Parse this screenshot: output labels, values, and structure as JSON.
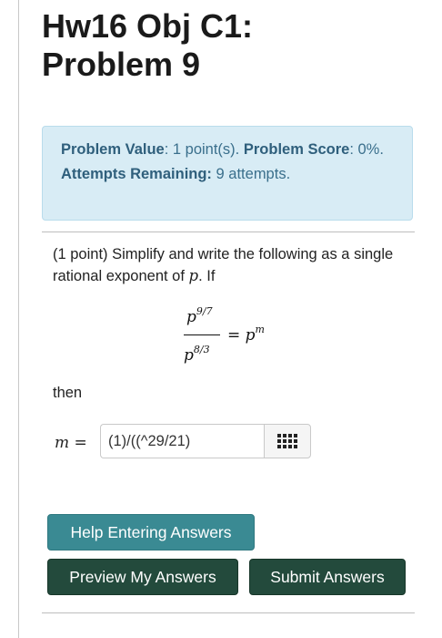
{
  "title": {
    "line1": "Hw16 Obj C1:",
    "line2": "Problem 9"
  },
  "info": {
    "value_label": "Problem Value",
    "value_text": ": 1 point(s).",
    "score_label": "Problem Score",
    "score_text": ": 0%.",
    "attempts_label": "Attempts Remaining:",
    "attempts_text": "9 attempts."
  },
  "problem": {
    "text_before": "(1 point) Simplify and write the following as a single rational exponent of",
    "var": "p",
    "text_after": ". If",
    "numerator_base": "p",
    "numerator_exp": "9/7",
    "denominator_base": "p",
    "denominator_exp": "8/3",
    "equals": "=",
    "rhs_base": "p",
    "rhs_exp": "m",
    "then": "then"
  },
  "answer": {
    "label_var": "m",
    "label_eq": "=",
    "value": "(1)/((^29/21)"
  },
  "buttons": {
    "help": "Help Entering Answers",
    "preview": "Preview My Answers",
    "submit": "Submit Answers"
  },
  "icons": {
    "equation_editor": "grid-icon"
  }
}
